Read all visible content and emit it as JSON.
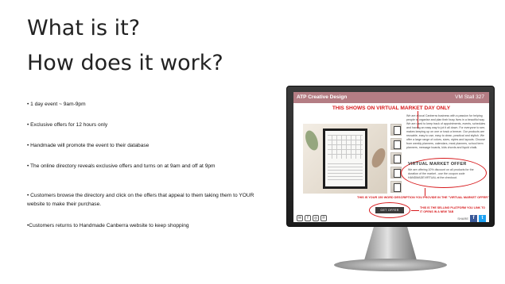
{
  "slide": {
    "title_line1": "What is it?",
    "title_line2": "How does it work?",
    "bullets": [
      "• 1 day event ~ 9am-9pm",
      "• Exclusive offers for 12 hours only",
      "• Handmade will promote the event to their database",
      "• The online directory reveals exclusive offers and turns on at 9am and off at 9pm",
      "• Customers browse the directory and click on the offers that appeal to them taking them to YOUR website to make their purchase.",
      "•Customers returns to Handmade Canberra website to keep shopping"
    ]
  },
  "mockup": {
    "brand": "ATP Creative Design",
    "stall": "VM Stall 327",
    "headline": "THIS SHOWS ON VIRTUAL MARKET DAY ONLY",
    "description": "We are a local Canberra business with a passion for helping people to organise and plan their busy lives in a beautiful way. We are used to keep track of appointments, events, schedules and having an easy way to jot it all down. For everyone to see, makes keeping up on one or track a breeze. Our products are reusable, easy to use, easy to clean, practical and stylish. We offer a large range of colors, sizes, styles and layouts. Choose from weekly planners, calendars, meal planners, school term planners, message boards, kids chords and liquid chalk.",
    "offer_title": "VIRTUAL MARKET OFFER",
    "offer_text": "We are offering 10% discount on all products for the duration of the market - use the coupon code HANDMADEVIRTUAL at the checkout.",
    "offer_note": "THIS IS YOUR 150 WORD DESCRIPTION YOU PROVIDE IN THE \"VIRTUAL MARKET OFFER\" SECTION",
    "buy_button": "GET OFFER",
    "buy_note": "THIS IS THE SELLING PLATFORM YOU LINK TO IT OPENS IN A NEW TAB",
    "share_label": "SHARE",
    "social_icons": [
      "mail-icon",
      "facebook-icon",
      "instagram-icon",
      "pinterest-icon"
    ],
    "colors": {
      "header_bar": "#b47d84",
      "callout_red": "#d7191c",
      "bezel": "#1b1b1b"
    }
  }
}
